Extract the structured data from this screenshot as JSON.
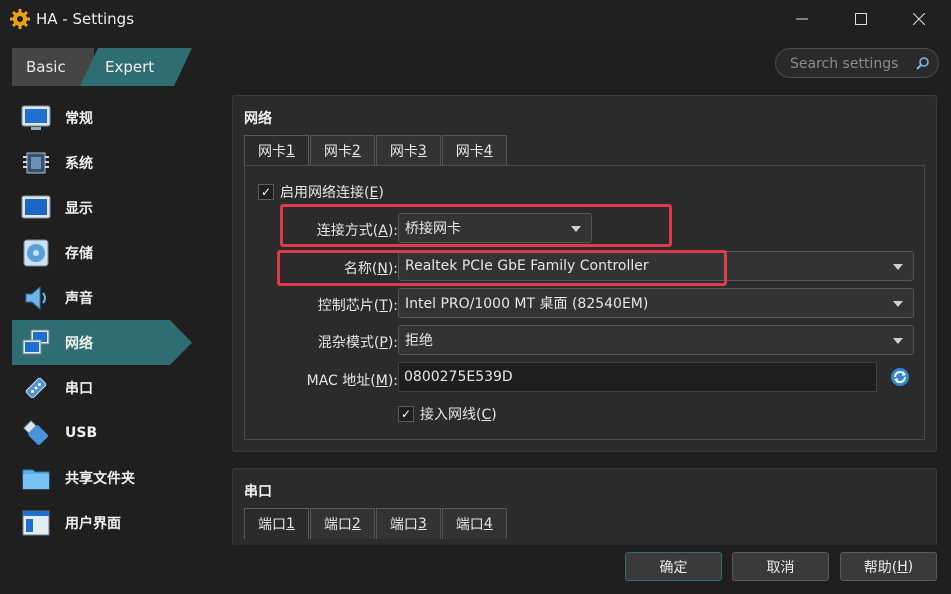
{
  "window": {
    "title": "HA - Settings",
    "icons": {
      "app": "gear-icon",
      "minimize": "minimize-icon",
      "maximize": "maximize-icon",
      "close": "close-icon"
    }
  },
  "mode_tabs": {
    "basic": "Basic",
    "expert": "Expert"
  },
  "search": {
    "placeholder": "Search settings"
  },
  "sidebar": {
    "items": [
      {
        "label": "常规",
        "icon": "general-monitor-icon"
      },
      {
        "label": "系统",
        "icon": "chip-icon"
      },
      {
        "label": "显示",
        "icon": "display-icon"
      },
      {
        "label": "存储",
        "icon": "storage-disc-icon"
      },
      {
        "label": "声音",
        "icon": "speaker-icon"
      },
      {
        "label": "网络",
        "icon": "network-icon",
        "active": true
      },
      {
        "label": "串口",
        "icon": "serial-port-icon"
      },
      {
        "label": "USB",
        "icon": "usb-icon"
      },
      {
        "label": "共享文件夹",
        "icon": "shared-folder-icon"
      },
      {
        "label": "用户界面",
        "icon": "user-interface-icon"
      }
    ]
  },
  "network": {
    "title": "网络",
    "tabs": [
      {
        "text": "网卡 ",
        "num": "1"
      },
      {
        "text": "网卡 ",
        "num": "2"
      },
      {
        "text": "网卡 ",
        "num": "3"
      },
      {
        "text": "网卡 ",
        "num": "4"
      }
    ],
    "enable": {
      "text": "启用网络连接(",
      "key": "E",
      "end": ")",
      "checked": true
    },
    "attached_to": {
      "text": "连接方式(",
      "key": "A",
      "end": "):",
      "value": "桥接网卡"
    },
    "name": {
      "text": "名称(",
      "key": "N",
      "end": "):",
      "value": "Realtek PCIe GbE Family Controller"
    },
    "adapter_type": {
      "text": "控制芯片(",
      "key": "T",
      "end": "):",
      "value": "Intel PRO/1000 MT 桌面 (82540EM)"
    },
    "promiscuous": {
      "text": "混杂模式(",
      "key": "P",
      "end": "):",
      "value": "拒绝"
    },
    "mac": {
      "text": "MAC 地址(",
      "key": "M",
      "end": "):",
      "value": "0800275E539D",
      "refresh_icon": "refresh-icon"
    },
    "cable": {
      "text": "接入网线(",
      "key": "C",
      "end": ")",
      "checked": true
    }
  },
  "serial": {
    "title": "串口",
    "tabs": [
      {
        "text": "端口 ",
        "num": "1"
      },
      {
        "text": "端口 ",
        "num": "2"
      },
      {
        "text": "端口 ",
        "num": "3"
      },
      {
        "text": "端口 ",
        "num": "4"
      }
    ]
  },
  "buttons": {
    "ok": "确定",
    "cancel": "取消",
    "help_text": "帮助(",
    "help_key": "H",
    "help_end": ")"
  },
  "colors": {
    "accent": "#2e6e73",
    "highlight_box": "#e03a4e",
    "background": "#1f1f1f"
  }
}
